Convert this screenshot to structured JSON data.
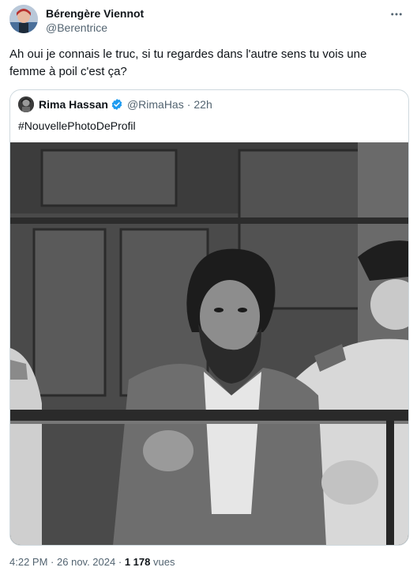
{
  "author": {
    "display_name": "Bérengère Viennot",
    "handle": "@Berentrice"
  },
  "post": {
    "text": "Ah oui je connais le truc, si tu regardes dans l'autre sens tu vois une femme à poil c'est ça?"
  },
  "quoted": {
    "display_name": "Rima Hassan",
    "handle": "@RimaHas",
    "separator": "·",
    "time": "22h",
    "text": "#NouvellePhotoDeProfil",
    "image_alt_icon": "photo-image"
  },
  "meta": {
    "time": "4:22 PM",
    "separator": "·",
    "date": "26 nov. 2024",
    "separator2": "·",
    "views_count": "1 178",
    "views_label": "vues"
  },
  "colors": {
    "secondary_text": "#536471",
    "verified_blue": "#1d9bf0",
    "border": "#cfd9de"
  },
  "icons": [
    "more-icon",
    "verified-icon"
  ]
}
